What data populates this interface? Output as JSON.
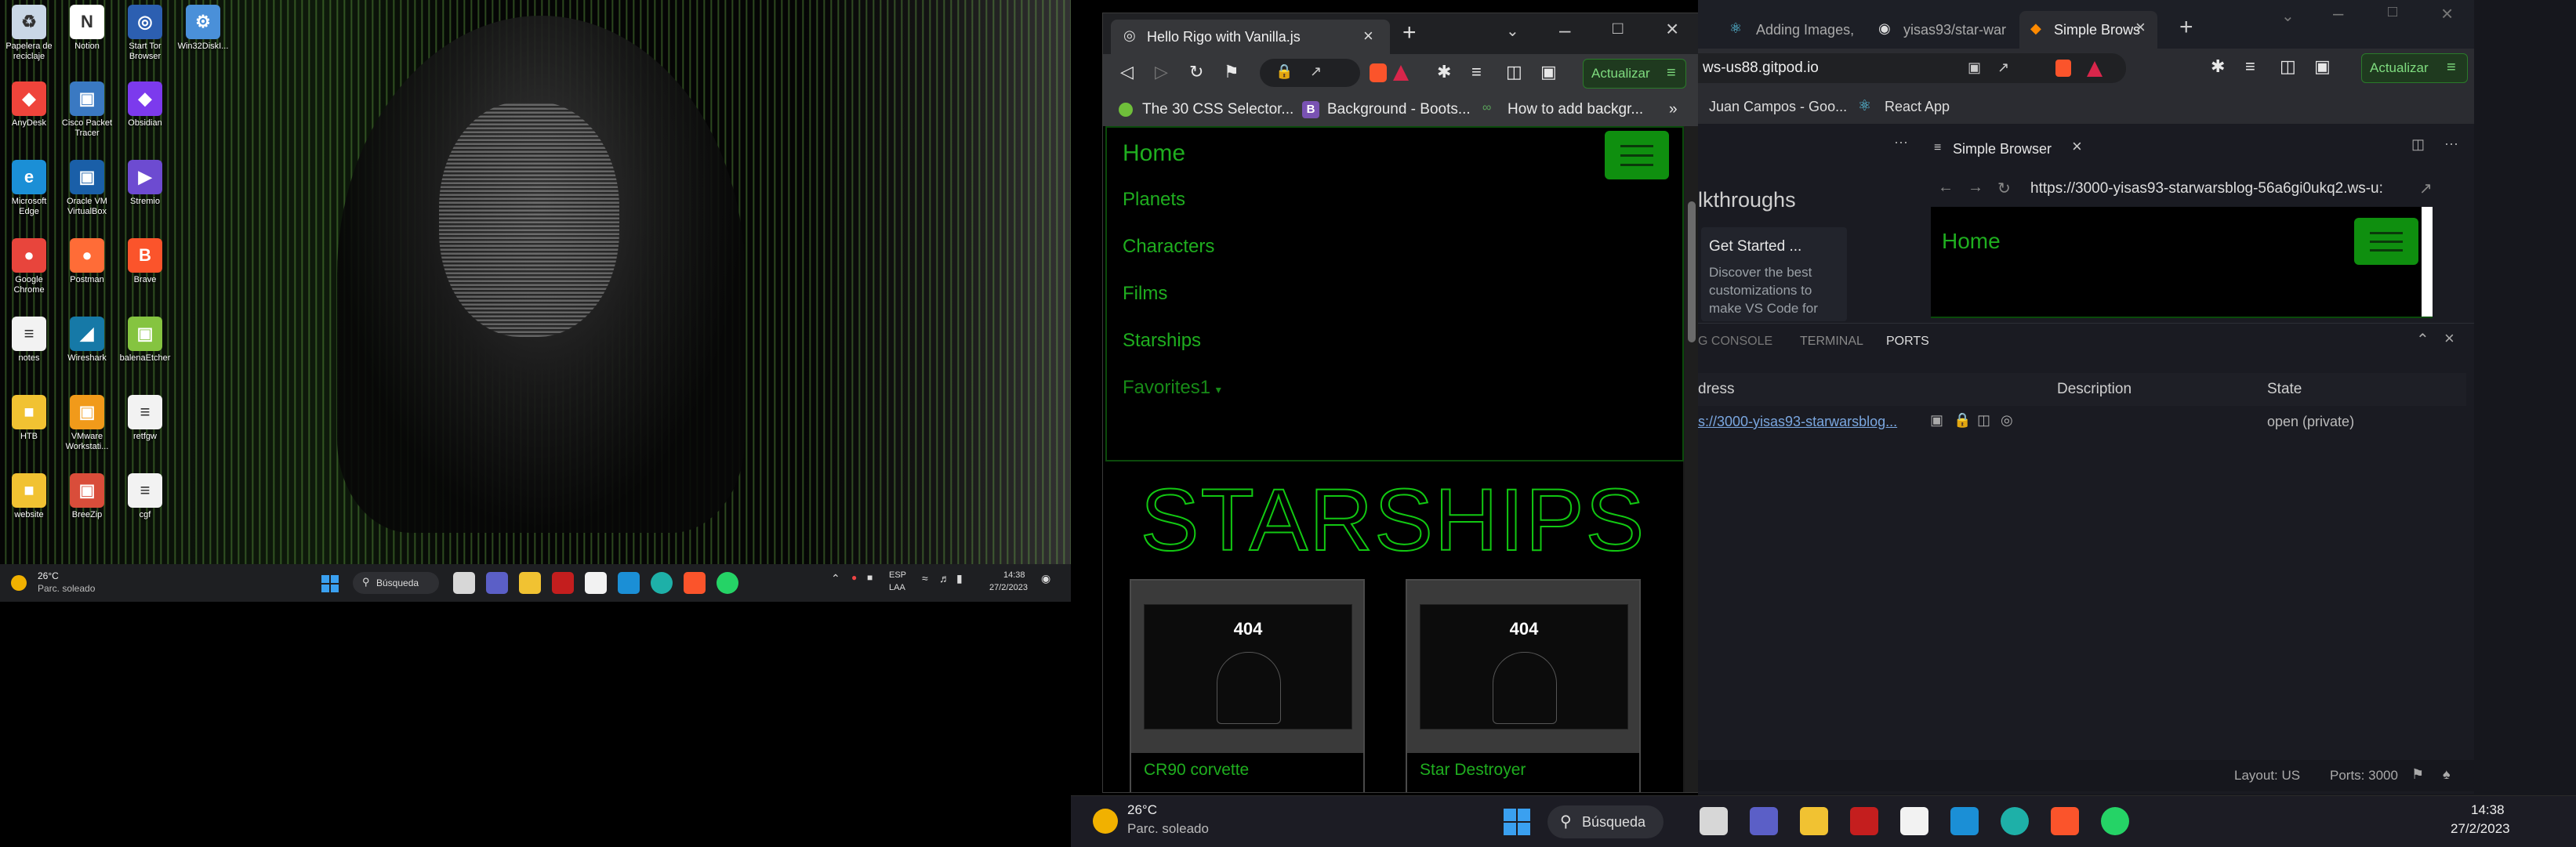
{
  "desktop": {
    "icons": [
      {
        "label": "Papelera de reciclaje",
        "color": "#c9d7e6",
        "glyph": "♻"
      },
      {
        "label": "Notion",
        "color": "#ffffff",
        "glyph": "N"
      },
      {
        "label": "Start Tor Browser",
        "color": "#2c5fb1",
        "glyph": "◎"
      },
      {
        "label": "Win32DiskI...",
        "color": "#4a90d9",
        "glyph": "⚙"
      },
      {
        "label": "AnyDesk",
        "color": "#ef443b",
        "glyph": "◆"
      },
      {
        "label": "Cisco Packet Tracer",
        "color": "#3a79c2",
        "glyph": "▣"
      },
      {
        "label": "Obsidian",
        "color": "#7c3aed",
        "glyph": "◆"
      },
      {
        "label": "Microsoft Edge",
        "color": "#1b8fd6",
        "glyph": "e"
      },
      {
        "label": "Oracle VM VirtualBox",
        "color": "#1a5fa8",
        "glyph": "▣"
      },
      {
        "label": "Stremio",
        "color": "#6d4bd1",
        "glyph": "▶"
      },
      {
        "label": "Google Chrome",
        "color": "#e8453c",
        "glyph": "●"
      },
      {
        "label": "Postman",
        "color": "#ff6c37",
        "glyph": "●"
      },
      {
        "label": "Brave",
        "color": "#fb542b",
        "glyph": "B"
      },
      {
        "label": "notes",
        "color": "#f2f2f2",
        "glyph": "≡"
      },
      {
        "label": "Wireshark",
        "color": "#1679a7",
        "glyph": "◢"
      },
      {
        "label": "balenaEtcher",
        "color": "#85c440",
        "glyph": "▣"
      },
      {
        "label": "HTB",
        "color": "#f1c232",
        "glyph": "■"
      },
      {
        "label": "VMware Workstati...",
        "color": "#f19a1a",
        "glyph": "▣"
      },
      {
        "label": "retfgw",
        "color": "#f2f2f2",
        "glyph": "≡"
      },
      {
        "label": "website",
        "color": "#f1c232",
        "glyph": "■"
      },
      {
        "label": "BreeZip",
        "color": "#d94d3a",
        "glyph": "▣"
      },
      {
        "label": "cgf",
        "color": "#f2f2f2",
        "glyph": "≡"
      }
    ]
  },
  "taskbar_left": {
    "weather_temp": "26°C",
    "weather_desc": "Parc. soleado",
    "search_label": "Búsqueda",
    "lang_top": "ESP",
    "lang_bottom": "LAA",
    "time": "14:38",
    "date": "27/2/2023"
  },
  "brave": {
    "tab_title": "Hello Rigo with Vanilla.js",
    "update_button": "Actualizar",
    "bookmarks": [
      "The 30 CSS Selector...",
      "Background - Boots...",
      "How to add backgr..."
    ],
    "bookmarks_more": "»",
    "site": {
      "nav_home": "Home",
      "nav_links": [
        "Planets",
        "Characters",
        "Films",
        "Starships",
        "Favorites1"
      ],
      "heading": "STARSHIPS",
      "cards": [
        {
          "image_text": "404",
          "title": "CR90 corvette"
        },
        {
          "image_text": "404",
          "title": "Star Destroyer"
        }
      ]
    }
  },
  "vscode": {
    "tabs": [
      {
        "label": "Adding Images,",
        "icon": "react-icon"
      },
      {
        "label": "yisas93/star-war",
        "icon": "github-icon"
      },
      {
        "label": "Simple Brows",
        "icon": "gitpod-icon"
      }
    ],
    "address_partial": "ws-us88.gitpod.io",
    "update_button": "Actualizar",
    "bookmarks": [
      "Juan Campos - Goo...",
      "React App"
    ],
    "walkthroughs_label": "lkthroughs",
    "get_started_title": "Get Started ...",
    "get_started_desc": "Discover the best customizations to make VS Code for",
    "simple_browser_tab": "Simple Browser",
    "simple_browser_url": "https://3000-yisas93-starwarsblog-56a6gi0ukq2.ws-u:",
    "preview_home": "Home",
    "panel_tabs": [
      "G CONSOLE",
      "TERMINAL",
      "PORTS"
    ],
    "ports_headers": [
      "dress",
      "Description",
      "State"
    ],
    "ports_row": {
      "address": "s://3000-yisas93-starwarsblog...",
      "state": "open (private)"
    },
    "status_layout": "Layout: US",
    "status_ports": "Ports: 3000"
  },
  "taskbar_right": {
    "weather_temp": "26°C",
    "weather_desc": "Parc. soleado",
    "search_label": "Búsqueda",
    "time": "14:38",
    "date": "27/2/2023"
  }
}
